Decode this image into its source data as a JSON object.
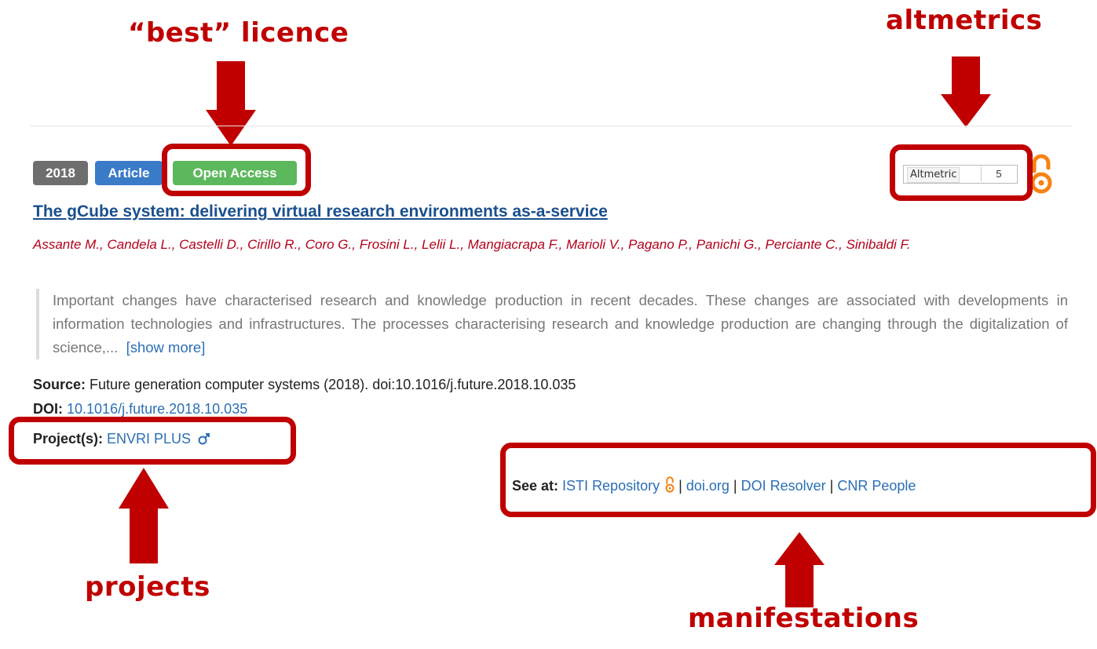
{
  "annotations": {
    "licence": "“best” licence",
    "altmetrics": "altmetrics",
    "projects": "projects",
    "manifestations": "manifestations"
  },
  "record": {
    "year": "2018",
    "type": "Article",
    "access": "Open Access",
    "altmetric": {
      "label": "Altmetric",
      "score": "5"
    },
    "title": "The gCube system: delivering virtual research environments as-a-service",
    "authors": "Assante M., Candela L., Castelli D., Cirillo R., Coro G., Frosini L., Lelii L., Mangiacrapa F., Marioli V., Pagano P., Panichi G., Perciante C., Sinibaldi F.",
    "abstract": "Important changes have characterised research and knowledge production in recent decades. These changes are associated with developments in information technologies and infrastructures. The processes characterising research and knowledge production are changing through the digitalization of science,...",
    "show_more": "[show more]",
    "source_label": "Source:",
    "source": "Future generation computer systems (2018). doi:10.1016/j.future.2018.10.035",
    "doi_label": "DOI:",
    "doi": "10.1016/j.future.2018.10.035",
    "projects_label": "Project(s):",
    "project": "ENVRI PLUS",
    "see_at_label": "See at:",
    "see_at": [
      "ISTI Repository",
      "doi.org",
      "DOI Resolver",
      "CNR People"
    ],
    "separator": "|"
  },
  "colors": {
    "annotation": "#c00000",
    "year_badge": "#6e6e6e",
    "type_badge": "#3a7bc8",
    "oa_badge": "#5cb85c",
    "link": "#2b6fb5",
    "authors": "#b3001b",
    "oa_icon": "#f68212"
  },
  "icons": [
    "open-access-icon",
    "male-symbol-icon",
    "down-arrow",
    "up-arrow"
  ]
}
